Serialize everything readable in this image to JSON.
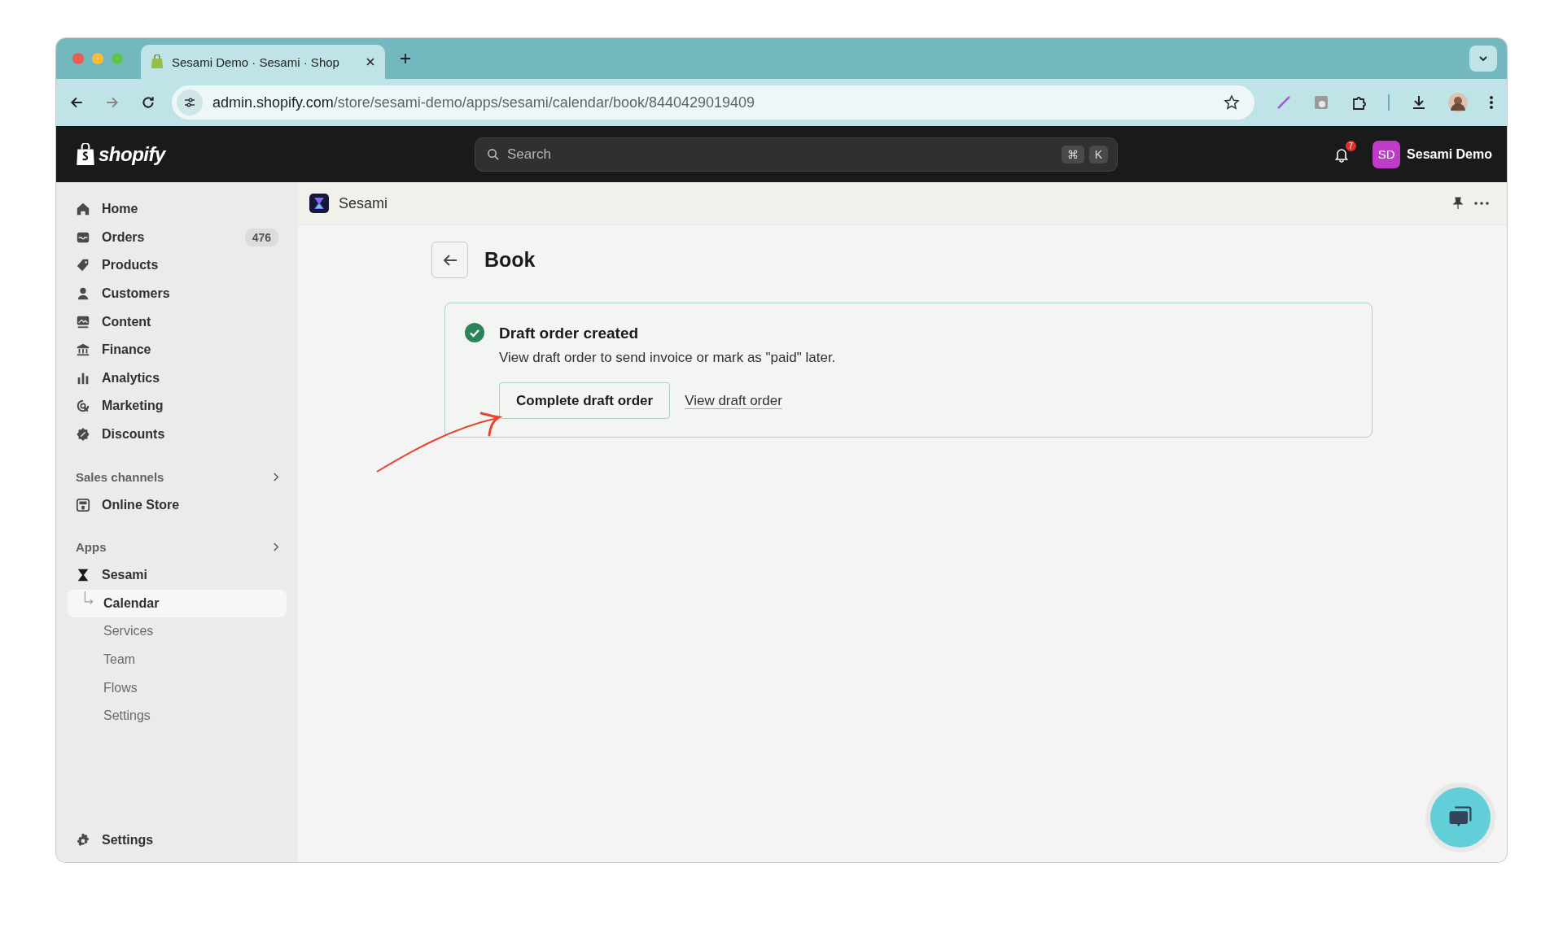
{
  "browser": {
    "tab_title": "Sesami Demo · Sesami · Shop",
    "url_host": "admin.shopify.com",
    "url_path": "/store/sesami-demo/apps/sesami/calendar/book/8440429019409"
  },
  "topbar": {
    "logo": "shopify",
    "search": {
      "placeholder": "Search"
    },
    "shortcut_keys": [
      "⌘",
      "K"
    ],
    "notification_count": "7",
    "avatar_initials": "SD",
    "store_name": "Sesami Demo"
  },
  "sidebar": {
    "items": [
      {
        "label": "Home",
        "selected": false
      },
      {
        "label": "Orders",
        "selected": false,
        "badge": "476"
      },
      {
        "label": "Products",
        "selected": false
      },
      {
        "label": "Customers",
        "selected": false
      },
      {
        "label": "Content",
        "selected": false
      },
      {
        "label": "Finance",
        "selected": false
      },
      {
        "label": "Analytics",
        "selected": false
      },
      {
        "label": "Marketing",
        "selected": false
      },
      {
        "label": "Discounts",
        "selected": false
      }
    ],
    "sections": [
      {
        "title": "Sales channels",
        "items": [
          {
            "label": "Online Store",
            "selected": false
          }
        ]
      },
      {
        "title": "Apps",
        "items": [
          {
            "label": "Sesami",
            "selected": false,
            "children": [
              {
                "label": "Calendar",
                "selected": true
              },
              {
                "label": "Services",
                "selected": false
              },
              {
                "label": "Team",
                "selected": false
              },
              {
                "label": "Flows",
                "selected": false
              },
              {
                "label": "Settings",
                "selected": false
              }
            ]
          }
        ]
      }
    ],
    "footer_item": {
      "label": "Settings",
      "selected": false
    }
  },
  "app_header": {
    "title": "Sesami"
  },
  "page": {
    "title": "Book"
  },
  "banner": {
    "title": "Draft order created",
    "message": "View draft order to send invoice or mark as \"paid\" later.",
    "primary_action": "Complete draft order",
    "secondary_action": "View draft order"
  }
}
